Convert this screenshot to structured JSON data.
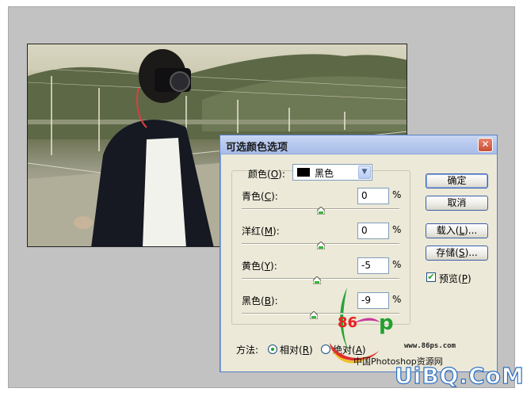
{
  "dialog": {
    "title": "可选颜色选项",
    "close_glyph": "✕",
    "colors_label_pre": "颜色(",
    "colors_label_key": "O",
    "colors_label_post": "):",
    "colors_value": "黑色",
    "colors_swatch": "#000000",
    "sliders": [
      {
        "label_pre": "青色(",
        "key": "C",
        "label_post": "):",
        "value": "0",
        "unit": "%",
        "level": 0
      },
      {
        "label_pre": "洋红(",
        "key": "M",
        "label_post": "):",
        "value": "0",
        "unit": "%",
        "level": 0
      },
      {
        "label_pre": "黄色(",
        "key": "Y",
        "label_post": "):",
        "value": "-5",
        "unit": "%",
        "level": -5
      },
      {
        "label_pre": "黑色(",
        "key": "B",
        "label_post": "):",
        "value": "-9",
        "unit": "%",
        "level": -9
      }
    ],
    "buttons": {
      "ok": "确定",
      "cancel": "取消",
      "load_pre": "载入(",
      "load_key": "L",
      "load_post": ")...",
      "save_pre": "存储(",
      "save_key": "S",
      "save_post": ")..."
    },
    "preview": {
      "pre": "预览(",
      "key": "P",
      "post": ")",
      "checked": true
    },
    "method": {
      "label": "方法:",
      "relative_pre": "相对(",
      "relative_key": "R",
      "relative_post": ")",
      "absolute_pre": "绝对(",
      "absolute_key": "A",
      "absolute_post": ")",
      "selected": "relative"
    }
  },
  "watermark": {
    "number": "86",
    "site": "www.86ps.com",
    "cn": "中国Photoshop资源网",
    "brand": "UiBQ.CoM"
  },
  "colors": {
    "accent": "#21a121",
    "dialog_bg": "#ece9d8",
    "title_bar": "#b6c8ee",
    "canvas_gray": "#c2c2c2"
  }
}
